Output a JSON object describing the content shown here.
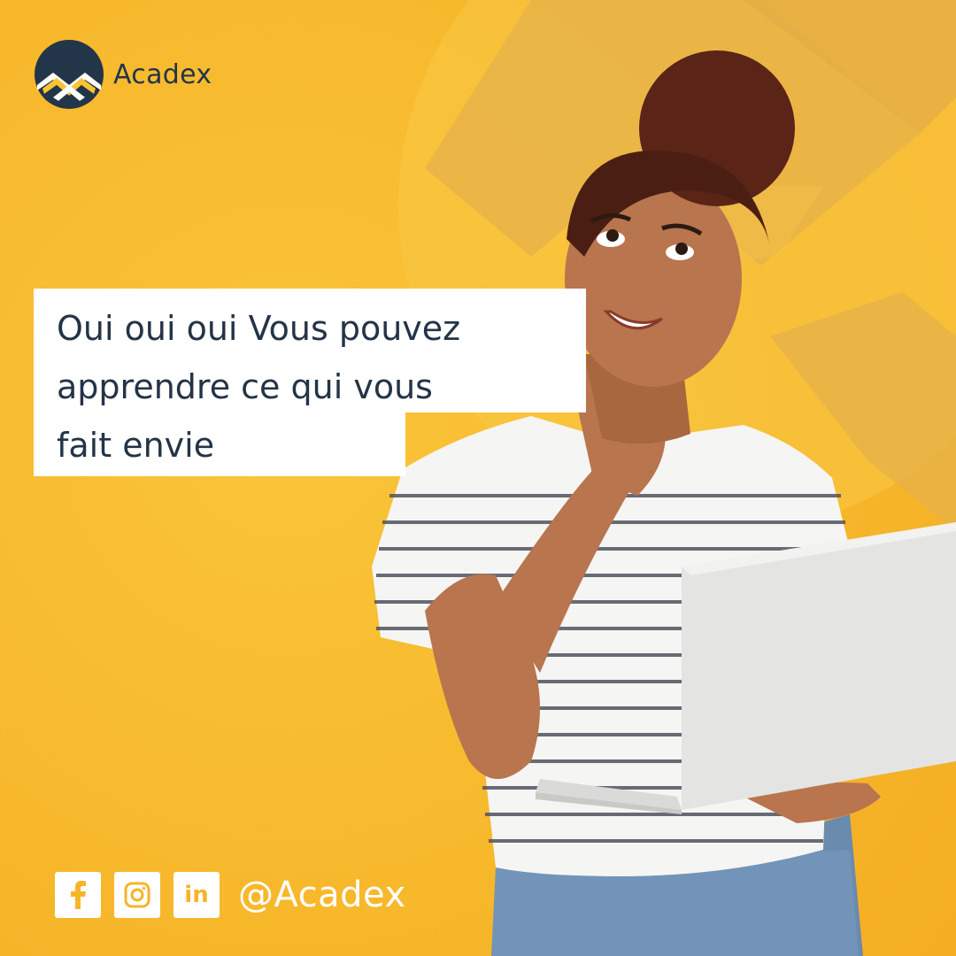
{
  "brand": {
    "name": "Acadex",
    "colors": {
      "background": "#F7BA2E",
      "navy": "#233549",
      "white": "#FFFFFF",
      "accent_yellow": "#F6B42A"
    }
  },
  "headline": {
    "text": "Oui  oui oui Vous pouvez\napprendre ce qui vous\nfait envie"
  },
  "footer": {
    "socials": [
      {
        "name": "facebook",
        "icon": "facebook-icon"
      },
      {
        "name": "instagram",
        "icon": "instagram-icon"
      },
      {
        "name": "linkedin",
        "icon": "linkedin-icon",
        "label": "in"
      }
    ],
    "handle": "@Acadex"
  }
}
